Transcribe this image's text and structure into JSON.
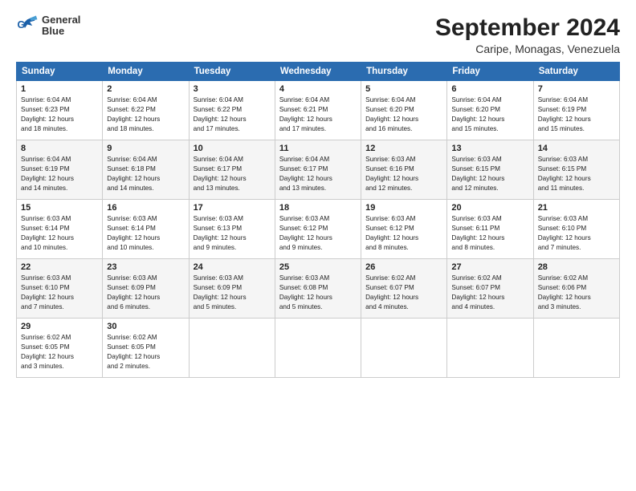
{
  "logo": {
    "line1": "General",
    "line2": "Blue"
  },
  "title": "September 2024",
  "subtitle": "Caripe, Monagas, Venezuela",
  "headers": [
    "Sunday",
    "Monday",
    "Tuesday",
    "Wednesday",
    "Thursday",
    "Friday",
    "Saturday"
  ],
  "weeks": [
    [
      {
        "day": "1",
        "info": "Sunrise: 6:04 AM\nSunset: 6:23 PM\nDaylight: 12 hours\nand 18 minutes."
      },
      {
        "day": "2",
        "info": "Sunrise: 6:04 AM\nSunset: 6:22 PM\nDaylight: 12 hours\nand 18 minutes."
      },
      {
        "day": "3",
        "info": "Sunrise: 6:04 AM\nSunset: 6:22 PM\nDaylight: 12 hours\nand 17 minutes."
      },
      {
        "day": "4",
        "info": "Sunrise: 6:04 AM\nSunset: 6:21 PM\nDaylight: 12 hours\nand 17 minutes."
      },
      {
        "day": "5",
        "info": "Sunrise: 6:04 AM\nSunset: 6:20 PM\nDaylight: 12 hours\nand 16 minutes."
      },
      {
        "day": "6",
        "info": "Sunrise: 6:04 AM\nSunset: 6:20 PM\nDaylight: 12 hours\nand 15 minutes."
      },
      {
        "day": "7",
        "info": "Sunrise: 6:04 AM\nSunset: 6:19 PM\nDaylight: 12 hours\nand 15 minutes."
      }
    ],
    [
      {
        "day": "8",
        "info": "Sunrise: 6:04 AM\nSunset: 6:19 PM\nDaylight: 12 hours\nand 14 minutes."
      },
      {
        "day": "9",
        "info": "Sunrise: 6:04 AM\nSunset: 6:18 PM\nDaylight: 12 hours\nand 14 minutes."
      },
      {
        "day": "10",
        "info": "Sunrise: 6:04 AM\nSunset: 6:17 PM\nDaylight: 12 hours\nand 13 minutes."
      },
      {
        "day": "11",
        "info": "Sunrise: 6:04 AM\nSunset: 6:17 PM\nDaylight: 12 hours\nand 13 minutes."
      },
      {
        "day": "12",
        "info": "Sunrise: 6:03 AM\nSunset: 6:16 PM\nDaylight: 12 hours\nand 12 minutes."
      },
      {
        "day": "13",
        "info": "Sunrise: 6:03 AM\nSunset: 6:15 PM\nDaylight: 12 hours\nand 12 minutes."
      },
      {
        "day": "14",
        "info": "Sunrise: 6:03 AM\nSunset: 6:15 PM\nDaylight: 12 hours\nand 11 minutes."
      }
    ],
    [
      {
        "day": "15",
        "info": "Sunrise: 6:03 AM\nSunset: 6:14 PM\nDaylight: 12 hours\nand 10 minutes."
      },
      {
        "day": "16",
        "info": "Sunrise: 6:03 AM\nSunset: 6:14 PM\nDaylight: 12 hours\nand 10 minutes."
      },
      {
        "day": "17",
        "info": "Sunrise: 6:03 AM\nSunset: 6:13 PM\nDaylight: 12 hours\nand 9 minutes."
      },
      {
        "day": "18",
        "info": "Sunrise: 6:03 AM\nSunset: 6:12 PM\nDaylight: 12 hours\nand 9 minutes."
      },
      {
        "day": "19",
        "info": "Sunrise: 6:03 AM\nSunset: 6:12 PM\nDaylight: 12 hours\nand 8 minutes."
      },
      {
        "day": "20",
        "info": "Sunrise: 6:03 AM\nSunset: 6:11 PM\nDaylight: 12 hours\nand 8 minutes."
      },
      {
        "day": "21",
        "info": "Sunrise: 6:03 AM\nSunset: 6:10 PM\nDaylight: 12 hours\nand 7 minutes."
      }
    ],
    [
      {
        "day": "22",
        "info": "Sunrise: 6:03 AM\nSunset: 6:10 PM\nDaylight: 12 hours\nand 7 minutes."
      },
      {
        "day": "23",
        "info": "Sunrise: 6:03 AM\nSunset: 6:09 PM\nDaylight: 12 hours\nand 6 minutes."
      },
      {
        "day": "24",
        "info": "Sunrise: 6:03 AM\nSunset: 6:09 PM\nDaylight: 12 hours\nand 5 minutes."
      },
      {
        "day": "25",
        "info": "Sunrise: 6:03 AM\nSunset: 6:08 PM\nDaylight: 12 hours\nand 5 minutes."
      },
      {
        "day": "26",
        "info": "Sunrise: 6:02 AM\nSunset: 6:07 PM\nDaylight: 12 hours\nand 4 minutes."
      },
      {
        "day": "27",
        "info": "Sunrise: 6:02 AM\nSunset: 6:07 PM\nDaylight: 12 hours\nand 4 minutes."
      },
      {
        "day": "28",
        "info": "Sunrise: 6:02 AM\nSunset: 6:06 PM\nDaylight: 12 hours\nand 3 minutes."
      }
    ],
    [
      {
        "day": "29",
        "info": "Sunrise: 6:02 AM\nSunset: 6:05 PM\nDaylight: 12 hours\nand 3 minutes."
      },
      {
        "day": "30",
        "info": "Sunrise: 6:02 AM\nSunset: 6:05 PM\nDaylight: 12 hours\nand 2 minutes."
      },
      {
        "day": "",
        "info": ""
      },
      {
        "day": "",
        "info": ""
      },
      {
        "day": "",
        "info": ""
      },
      {
        "day": "",
        "info": ""
      },
      {
        "day": "",
        "info": ""
      }
    ]
  ]
}
